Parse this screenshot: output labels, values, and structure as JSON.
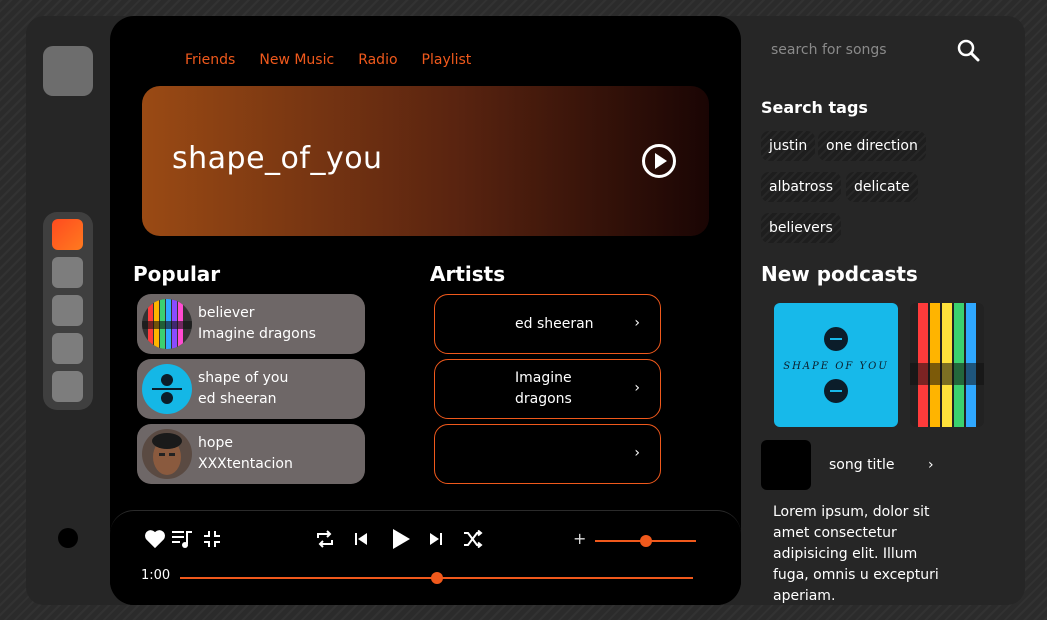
{
  "nav": [
    "Friends",
    "New Music",
    "Radio",
    "Playlist"
  ],
  "hero": {
    "title": "shape_of_you"
  },
  "popular": {
    "heading": "Popular",
    "songs": [
      {
        "title": "believer",
        "artist": "Imagine dragons"
      },
      {
        "title": "shape of you",
        "artist": "ed sheeran"
      },
      {
        "title": "hope",
        "artist": "XXXtentacion"
      }
    ]
  },
  "artists": {
    "heading": "Artists",
    "items": [
      "ed sheeran",
      "Imagine dragons",
      ""
    ],
    "chevron": "›"
  },
  "player": {
    "time": "1:00",
    "volume_plus": "+",
    "volume_level": 0.5,
    "progress": 0.5
  },
  "search": {
    "placeholder": "search for songs"
  },
  "tags": {
    "heading": "Search tags",
    "items": [
      "justin",
      "one direction",
      "albatross",
      "delicate",
      "believers"
    ]
  },
  "podcasts": {
    "heading": "New podcasts",
    "album_text": "SHAPE OF YOU",
    "song_title": "song title",
    "chevron": "›",
    "description": "Lorem ipsum, dolor sit amet consectetur adipisicing elit. Illum fuga, omnis u excepturi aperiam."
  },
  "colors": {
    "accent": "#f0591c",
    "card": "#6e6767",
    "panel": "#262626"
  }
}
